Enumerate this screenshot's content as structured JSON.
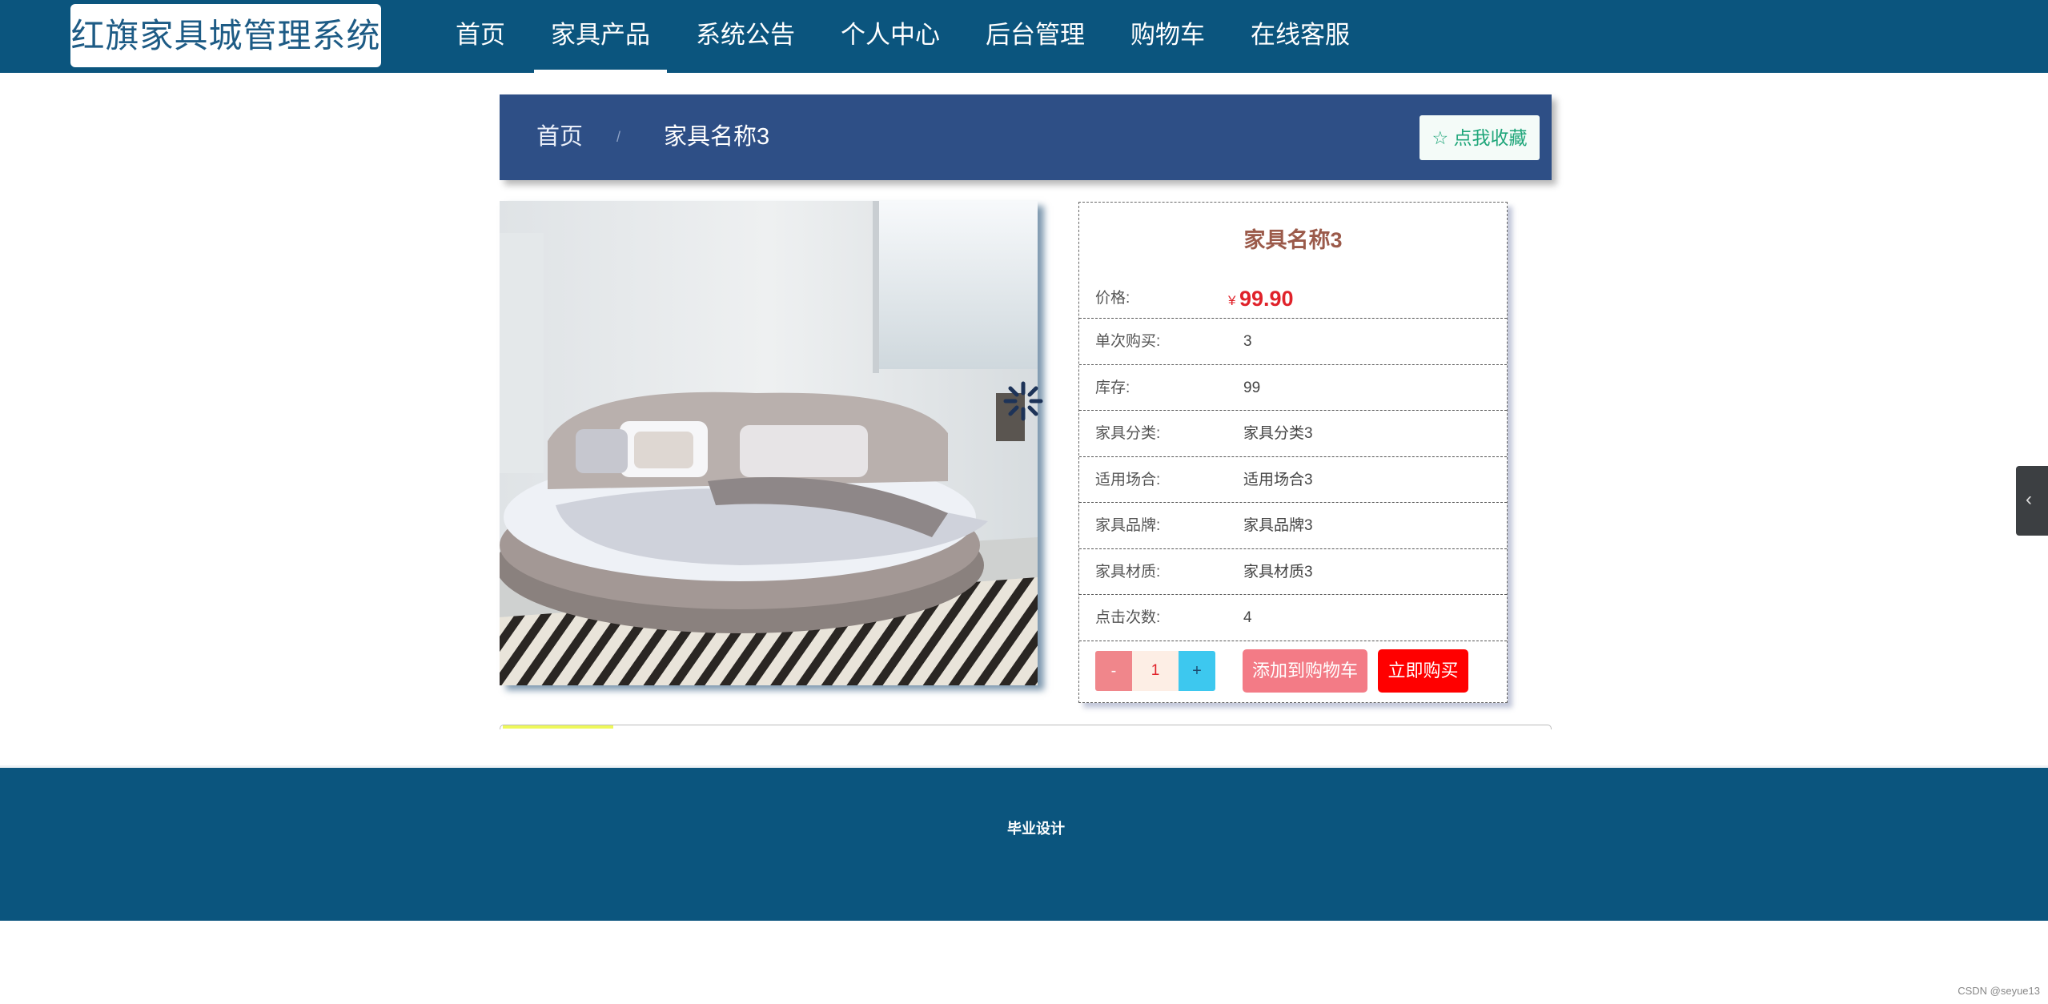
{
  "site": {
    "title": "红旗家具城管理系统"
  },
  "nav": {
    "items": [
      {
        "label": "首页"
      },
      {
        "label": "家具产品",
        "active": true
      },
      {
        "label": "系统公告"
      },
      {
        "label": "个人中心"
      },
      {
        "label": "后台管理"
      },
      {
        "label": "购物车"
      },
      {
        "label": "在线客服"
      }
    ]
  },
  "breadcrumb": {
    "home": "首页",
    "separator": "/",
    "current": "家具名称3"
  },
  "favorite_button": {
    "label": "☆ 点我收藏"
  },
  "product": {
    "image_icon": "round-bed-photo",
    "name": "家具名称3",
    "price_label": "价格:",
    "price_symbol": "¥",
    "price": "99.90",
    "attributes": [
      {
        "label": "单次购买:",
        "value": "3"
      },
      {
        "label": "库存:",
        "value": "99"
      },
      {
        "label": "家具分类:",
        "value": "家具分类3"
      },
      {
        "label": "适用场合:",
        "value": "适用场合3"
      },
      {
        "label": "家具品牌:",
        "value": "家具品牌3"
      },
      {
        "label": "家具材质:",
        "value": "家具材质3"
      },
      {
        "label": "点击次数:",
        "value": "4"
      }
    ]
  },
  "quantity": {
    "minus": "-",
    "value": "1",
    "plus": "+"
  },
  "actions": {
    "add_to_cart": "添加到购物车",
    "buy_now": "立即购买"
  },
  "side_toggle": {
    "icon": "chevron-left-icon",
    "glyph": "‹"
  },
  "footer": {
    "text": "毕业设计"
  },
  "watermark": "CSDN @seyue13",
  "colors": {
    "nav_bg": "#0b557e",
    "breadcrumb_bg": "#2e4f86",
    "price": "#e0222a",
    "buy": "#ff0000",
    "cart": "#f37b86"
  }
}
